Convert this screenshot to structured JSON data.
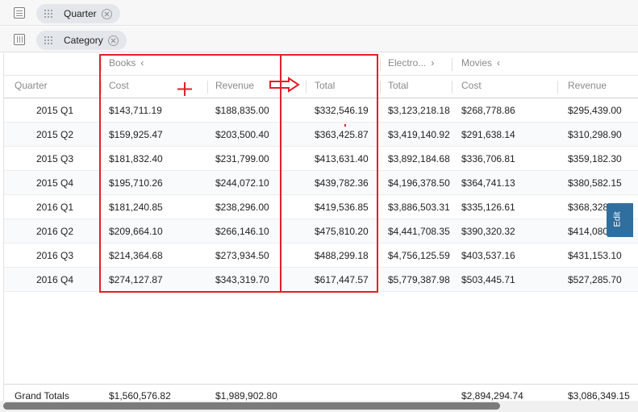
{
  "shelves": {
    "rows": {
      "pill_label": "Quarter",
      "icon": "rows-icon"
    },
    "columns": {
      "pill_label": "Category",
      "icon": "columns-icon"
    }
  },
  "groups": [
    {
      "label": "Books",
      "chevron": "‹"
    },
    {
      "label": "Electro...",
      "chevron": "›"
    },
    {
      "label": "Movies",
      "chevron": "‹"
    }
  ],
  "columns": {
    "quarter": "Quarter",
    "books_cost": "Cost",
    "books_revenue": "Revenue",
    "books_total": "Total",
    "electro_total": "Total",
    "movies_cost": "Cost",
    "movies_revenue": "Revenue"
  },
  "rows": [
    {
      "quarter": "2015 Q1",
      "books_cost": "$143,711.19",
      "books_revenue": "$188,835.00",
      "books_total": "$332,546.19",
      "electro_total": "$3,123,218.18",
      "movies_cost": "$268,778.86",
      "movies_revenue": "$295,439.00"
    },
    {
      "quarter": "2015 Q2",
      "books_cost": "$159,925.47",
      "books_revenue": "$203,500.40",
      "books_total": "$363,425.87",
      "electro_total": "$3,419,140.92",
      "movies_cost": "$291,638.14",
      "movies_revenue": "$310,298.90"
    },
    {
      "quarter": "2015 Q3",
      "books_cost": "$181,832.40",
      "books_revenue": "$231,799.00",
      "books_total": "$413,631.40",
      "electro_total": "$3,892,184.68",
      "movies_cost": "$336,706.81",
      "movies_revenue": "$359,182.30"
    },
    {
      "quarter": "2015 Q4",
      "books_cost": "$195,710.26",
      "books_revenue": "$244,072.10",
      "books_total": "$439,782.36",
      "electro_total": "$4,196,378.50",
      "movies_cost": "$364,741.13",
      "movies_revenue": "$380,582.15"
    },
    {
      "quarter": "2016 Q1",
      "books_cost": "$181,240.85",
      "books_revenue": "$238,296.00",
      "books_total": "$419,536.85",
      "electro_total": "$3,886,503.31",
      "movies_cost": "$335,126.61",
      "movies_revenue": "$368,328"
    },
    {
      "quarter": "2016 Q2",
      "books_cost": "$209,664.10",
      "books_revenue": "$266,146.10",
      "books_total": "$475,810.20",
      "electro_total": "$4,441,708.35",
      "movies_cost": "$390,320.32",
      "movies_revenue": "$414,080"
    },
    {
      "quarter": "2016 Q3",
      "books_cost": "$214,364.68",
      "books_revenue": "$273,934.50",
      "books_total": "$488,299.18",
      "electro_total": "$4,756,125.59",
      "movies_cost": "$403,537.16",
      "movies_revenue": "$431,153.10"
    },
    {
      "quarter": "2016 Q4",
      "books_cost": "$274,127.87",
      "books_revenue": "$343,319.70",
      "books_total": "$617,447.57",
      "electro_total": "$5,779,387.98",
      "movies_cost": "$503,445.71",
      "movies_revenue": "$527,285.70"
    }
  ],
  "grand_totals": {
    "label": "Grand Totals",
    "books_cost": "$1,560,576.82",
    "books_revenue": "$1,989,902.80",
    "movies_cost": "$2,894,294.74",
    "movies_revenue": "$3,086,349.15"
  },
  "edit_tab": {
    "label": "Edit"
  },
  "side_label": "",
  "annotation_color": "#e0202a"
}
